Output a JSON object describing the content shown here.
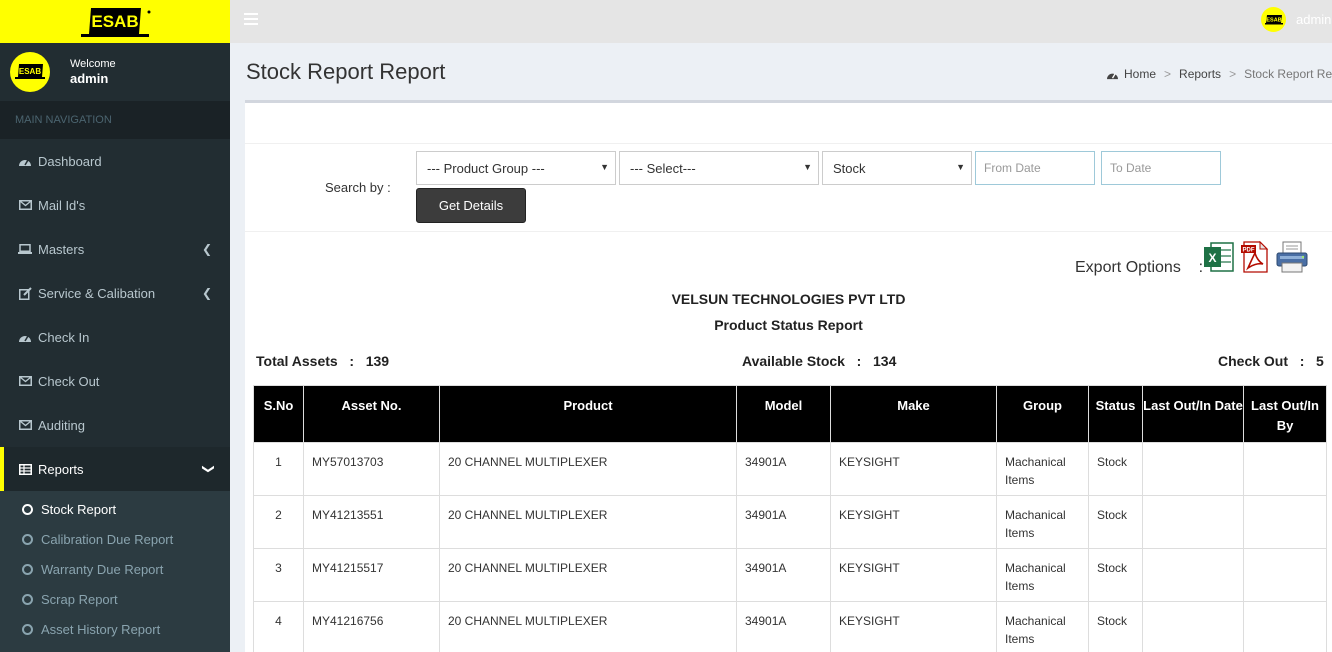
{
  "brand": {
    "logo_text": "ESAB"
  },
  "user": {
    "welcome": "Welcome",
    "name": "admin"
  },
  "sidebar": {
    "header": "MAIN NAVIGATION",
    "items": [
      {
        "label": "Dashboard",
        "icon": "dashboard-icon"
      },
      {
        "label": "Mail Id's",
        "icon": "envelope-icon"
      },
      {
        "label": "Masters",
        "icon": "laptop-icon"
      },
      {
        "label": "Service & Calibation",
        "icon": "edit-icon"
      },
      {
        "label": "Check In",
        "icon": "dashboard-icon"
      },
      {
        "label": "Check Out",
        "icon": "envelope-icon"
      },
      {
        "label": "Auditing",
        "icon": "envelope-icon"
      },
      {
        "label": "Reports",
        "icon": "table-icon"
      }
    ],
    "sub_items": [
      {
        "label": "Stock Report"
      },
      {
        "label": "Calibration Due Report"
      },
      {
        "label": "Warranty Due Report"
      },
      {
        "label": "Scrap Report"
      },
      {
        "label": "Asset History Report"
      }
    ]
  },
  "topbar": {
    "user_name": "admin"
  },
  "page": {
    "title": "Stock Report Report",
    "breadcrumb": [
      "Home",
      "Reports",
      "Stock Report Report"
    ]
  },
  "search": {
    "label": "Search by :",
    "product_group": "--- Product Group ---",
    "select": "--- Select---",
    "status": "Stock",
    "from_placeholder": "From Date",
    "to_placeholder": "To Date",
    "button": "Get Details"
  },
  "export": {
    "label": "Export Options",
    "colon": ":",
    "icons": [
      "excel-icon",
      "pdf-icon",
      "print-icon"
    ]
  },
  "report": {
    "company": "VELSUN TECHNOLOGIES PVT LTD",
    "title": "Product Status Report",
    "total_assets_label": "Total Assets",
    "total_assets": "139",
    "available_label": "Available Stock",
    "available": "134",
    "checkout_label": "Check Out",
    "checkout": "5",
    "colon": ":"
  },
  "table": {
    "headers": [
      "S.No",
      "Asset No.",
      "Product",
      "Model",
      "Make",
      "Group",
      "Status",
      "Last Out/In Date",
      "Last Out/In By"
    ],
    "rows": [
      [
        "1",
        "MY57013703",
        "20 CHANNEL MULTIPLEXER",
        "34901A",
        "KEYSIGHT",
        "Machanical Items",
        "Stock",
        "",
        ""
      ],
      [
        "2",
        "MY41213551",
        "20 CHANNEL MULTIPLEXER",
        "34901A",
        "KEYSIGHT",
        "Machanical Items",
        "Stock",
        "",
        ""
      ],
      [
        "3",
        "MY41215517",
        "20 CHANNEL MULTIPLEXER",
        "34901A",
        "KEYSIGHT",
        "Machanical Items",
        "Stock",
        "",
        ""
      ],
      [
        "4",
        "MY41216756",
        "20 CHANNEL MULTIPLEXER",
        "34901A",
        "KEYSIGHT",
        "Machanical Items",
        "Stock",
        "",
        ""
      ]
    ]
  }
}
